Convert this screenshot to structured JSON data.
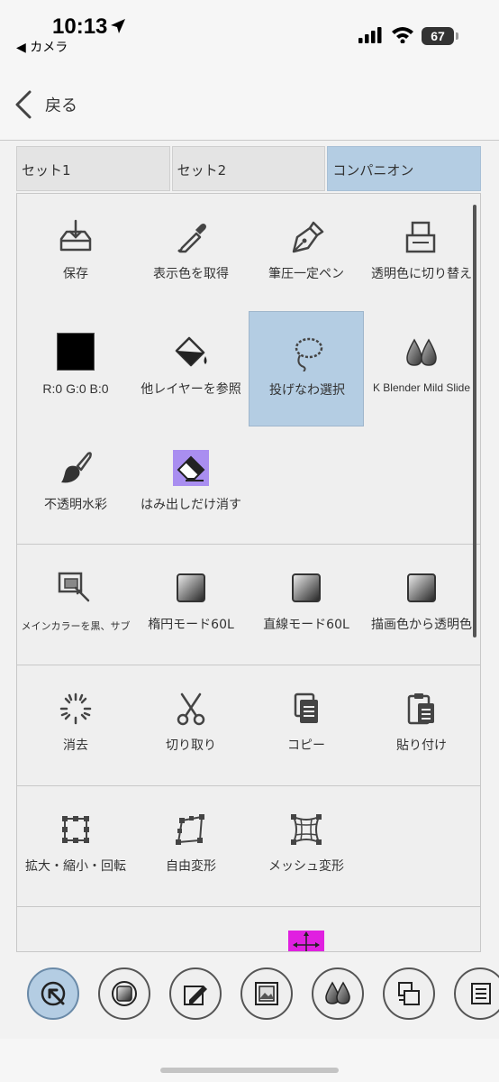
{
  "status": {
    "time": "10:13",
    "back_app": "◀ カメラ",
    "battery": "67"
  },
  "nav": {
    "back_label": "戻る"
  },
  "tabs": [
    {
      "label": "セット1",
      "active": false
    },
    {
      "label": "セット2",
      "active": false
    },
    {
      "label": "コンパニオン",
      "active": true
    }
  ],
  "sections": {
    "s1": {
      "items": [
        {
          "label": "保存",
          "icon": "save-icon"
        },
        {
          "label": "表示色を取得",
          "icon": "eyedropper-icon"
        },
        {
          "label": "筆圧一定ペン",
          "icon": "pen-nib-icon"
        },
        {
          "label": "透明色に切り替え",
          "icon": "transparent-color-icon"
        },
        {
          "label": "R:0 G:0 B:0",
          "icon": "color-swatch-icon",
          "swatch": "#000000"
        },
        {
          "label": "他レイヤーを参照",
          "icon": "paint-bucket-icon"
        },
        {
          "label": "投げなわ選択",
          "icon": "lasso-icon",
          "selected": true
        },
        {
          "label": "K Blender Mild Slide",
          "icon": "blender-drops-icon"
        },
        {
          "label": "不透明水彩",
          "icon": "watercolor-brush-icon"
        },
        {
          "label": "はみ出しだけ消す",
          "icon": "eraser-icon",
          "highlight": "#a98ef0"
        }
      ]
    },
    "s2": {
      "items": [
        {
          "label": "メインカラーを黒、サブ",
          "icon": "main-color-icon"
        },
        {
          "label": "楕円モード60L",
          "icon": "gradient-square-icon"
        },
        {
          "label": "直線モード60L",
          "icon": "gradient-square-icon"
        },
        {
          "label": "描画色から透明色",
          "icon": "gradient-square-icon"
        }
      ]
    },
    "s3": {
      "items": [
        {
          "label": "消去",
          "icon": "clear-icon"
        },
        {
          "label": "切り取り",
          "icon": "scissors-icon"
        },
        {
          "label": "コピー",
          "icon": "copy-icon"
        },
        {
          "label": "貼り付け",
          "icon": "paste-icon"
        }
      ]
    },
    "s4": {
      "items": [
        {
          "label": "拡大・縮小・回転",
          "icon": "scale-rotate-icon"
        },
        {
          "label": "自由変形",
          "icon": "free-transform-icon"
        },
        {
          "label": "メッシュ変形",
          "icon": "mesh-transform-icon"
        }
      ]
    },
    "s5": {
      "items": [
        {
          "label": "",
          "icon": "flip-horizontal-icon"
        },
        {
          "label": "",
          "icon": "merge-down-icon"
        },
        {
          "label": "",
          "icon": "move-icon",
          "highlight": "#e020e0"
        }
      ]
    }
  },
  "toolbar": [
    {
      "icon": "selection-tool-icon",
      "active": true
    },
    {
      "icon": "square-tool-icon"
    },
    {
      "icon": "edit-image-tool-icon"
    },
    {
      "icon": "image-tool-icon"
    },
    {
      "icon": "drops-tool-icon"
    },
    {
      "icon": "transparent-tool-icon"
    },
    {
      "icon": "layer-tool-icon"
    }
  ]
}
